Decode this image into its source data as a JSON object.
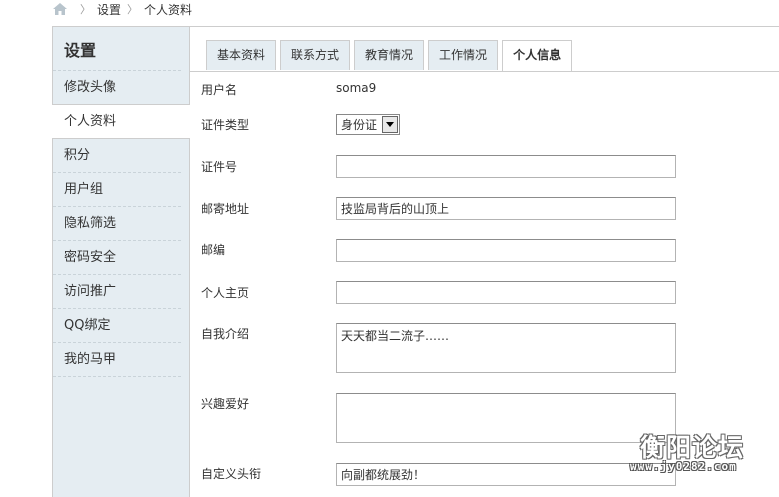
{
  "breadcrumb": {
    "home_icon": "home-icon",
    "items": [
      "设置",
      "个人资料"
    ]
  },
  "sidebar": {
    "title": "设置",
    "items": [
      {
        "label": "修改头像",
        "active": false
      },
      {
        "label": "个人资料",
        "active": true
      },
      {
        "label": "积分",
        "active": false
      },
      {
        "label": "用户组",
        "active": false
      },
      {
        "label": "隐私筛选",
        "active": false
      },
      {
        "label": "密码安全",
        "active": false
      },
      {
        "label": "访问推广",
        "active": false
      },
      {
        "label": "QQ绑定",
        "active": false
      },
      {
        "label": "我的马甲",
        "active": false
      }
    ]
  },
  "tabs": [
    {
      "label": "基本资料",
      "active": false
    },
    {
      "label": "联系方式",
      "active": false
    },
    {
      "label": "教育情况",
      "active": false
    },
    {
      "label": "工作情况",
      "active": false
    },
    {
      "label": "个人信息",
      "active": true
    }
  ],
  "form": {
    "username_label": "用户名",
    "username_value": "soma9",
    "id_type_label": "证件类型",
    "id_type_value": "身份证",
    "id_number_label": "证件号",
    "id_number_value": "",
    "address_label": "邮寄地址",
    "address_value": "技监局背后的山顶上",
    "zipcode_label": "邮编",
    "zipcode_value": "",
    "homepage_label": "个人主页",
    "homepage_value": "",
    "bio_label": "自我介绍",
    "bio_value": "天天都当二流子……",
    "interests_label": "兴趣爱好",
    "interests_value": "",
    "custom_title_label": "自定义头衔",
    "custom_title_value": "向副都统展劲！"
  },
  "watermark": {
    "title": "衡阳论坛",
    "url": "www.jy0282.com"
  },
  "colors": {
    "sidebar_bg": "#e5edf2",
    "border": "#cdcdcd"
  }
}
